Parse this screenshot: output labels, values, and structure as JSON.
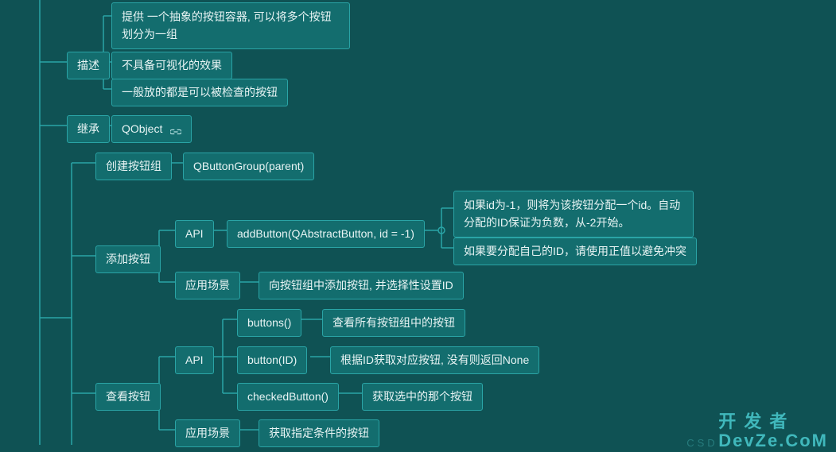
{
  "nodes": {
    "desc_label": "描述",
    "desc_1": "提供 一个抽象的按钮容器, 可以将多个按钮划分为一组",
    "desc_2": "不具备可视化的效果",
    "desc_3": "一般放的都是可以被检查的按钮",
    "inherit_label": "继承",
    "inherit_val": "QObject",
    "create_label": "创建按钮组",
    "create_val": "QButtonGroup(parent)",
    "add_label": "添加按钮",
    "add_api_label": "API",
    "add_api_val": "addButton(QAbstractButton, id = -1)",
    "add_note1": "如果id为-1，则将为该按钮分配一个id。自动分配的ID保证为负数，从-2开始。",
    "add_note2": "如果要分配自己的ID，请使用正值以避免冲突",
    "add_scene_label": "应用场景",
    "add_scene_val": "向按钮组中添加按钮, 并选择性设置ID",
    "view_label": "查看按钮",
    "view_api_label": "API",
    "api_buttons": "buttons()",
    "api_buttons_desc": "查看所有按钮组中的按钮",
    "api_button_id": "button(ID)",
    "api_button_id_desc": "根据ID获取对应按钮, 没有则返回None",
    "api_checked": "checkedButton()",
    "api_checked_desc": "获取选中的那个按钮",
    "view_scene_label": "应用场景",
    "view_scene_val": "获取指定条件的按钮"
  },
  "watermark": {
    "line1": "开 发 者",
    "line2": "DevZe.CoM",
    "sub": "CSD"
  }
}
